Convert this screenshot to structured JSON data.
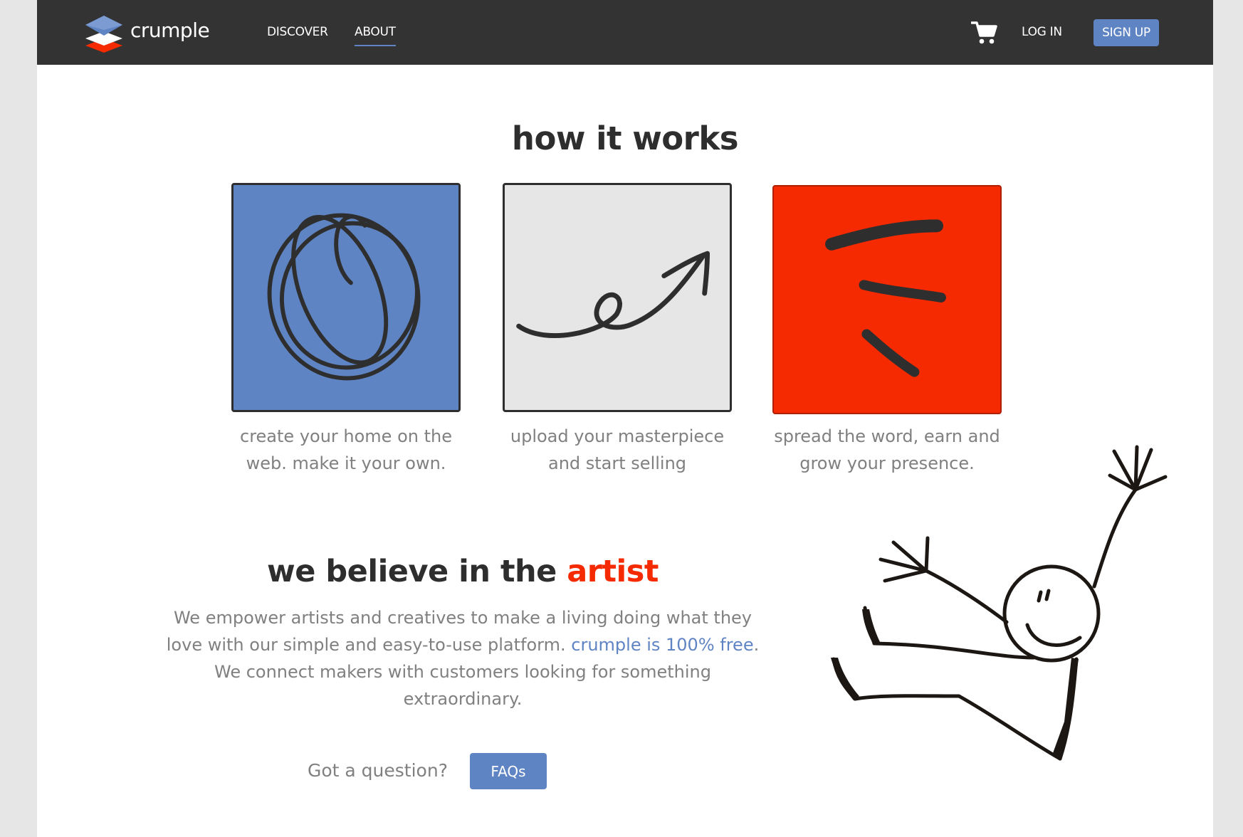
{
  "nav": {
    "brand": "crumple",
    "links": [
      "DISCOVER",
      "ABOUT"
    ],
    "active_link": "ABOUT",
    "cart_icon": "shopping-cart-icon",
    "login_label": "LOG IN",
    "signup_label": "SIGN UP"
  },
  "how_it_works": {
    "title": "how it works",
    "steps": [
      {
        "icon": "scribble-circle-icon",
        "caption": "create your home on the web. make it your own."
      },
      {
        "icon": "loop-arrow-icon",
        "caption": "upload your masterpiece and start selling"
      },
      {
        "icon": "brush-strokes-icon",
        "caption": "spread the word, earn and grow your presence."
      }
    ]
  },
  "believe": {
    "title_prefix": "we believe in the",
    "title_accent": "artist",
    "body_line_1": "We empower artists and creatives to make a living doing what they love with our simple and easy-to-use platform.",
    "free_link": "crumple is 100% free",
    "body_line_2": ". We connect makers with customers looking for something extraordinary.",
    "question": "Got a question?",
    "faqs_label": "FAQs"
  },
  "illustration": "jumping-stick-figure",
  "colors": {
    "nav_bg": "#333333",
    "brand_blue": "#5f84c4",
    "accent_red": "#f52a00",
    "tile_gray": "#e6e6e6",
    "text_gray": "#808080",
    "heading": "#2e2e2e"
  }
}
